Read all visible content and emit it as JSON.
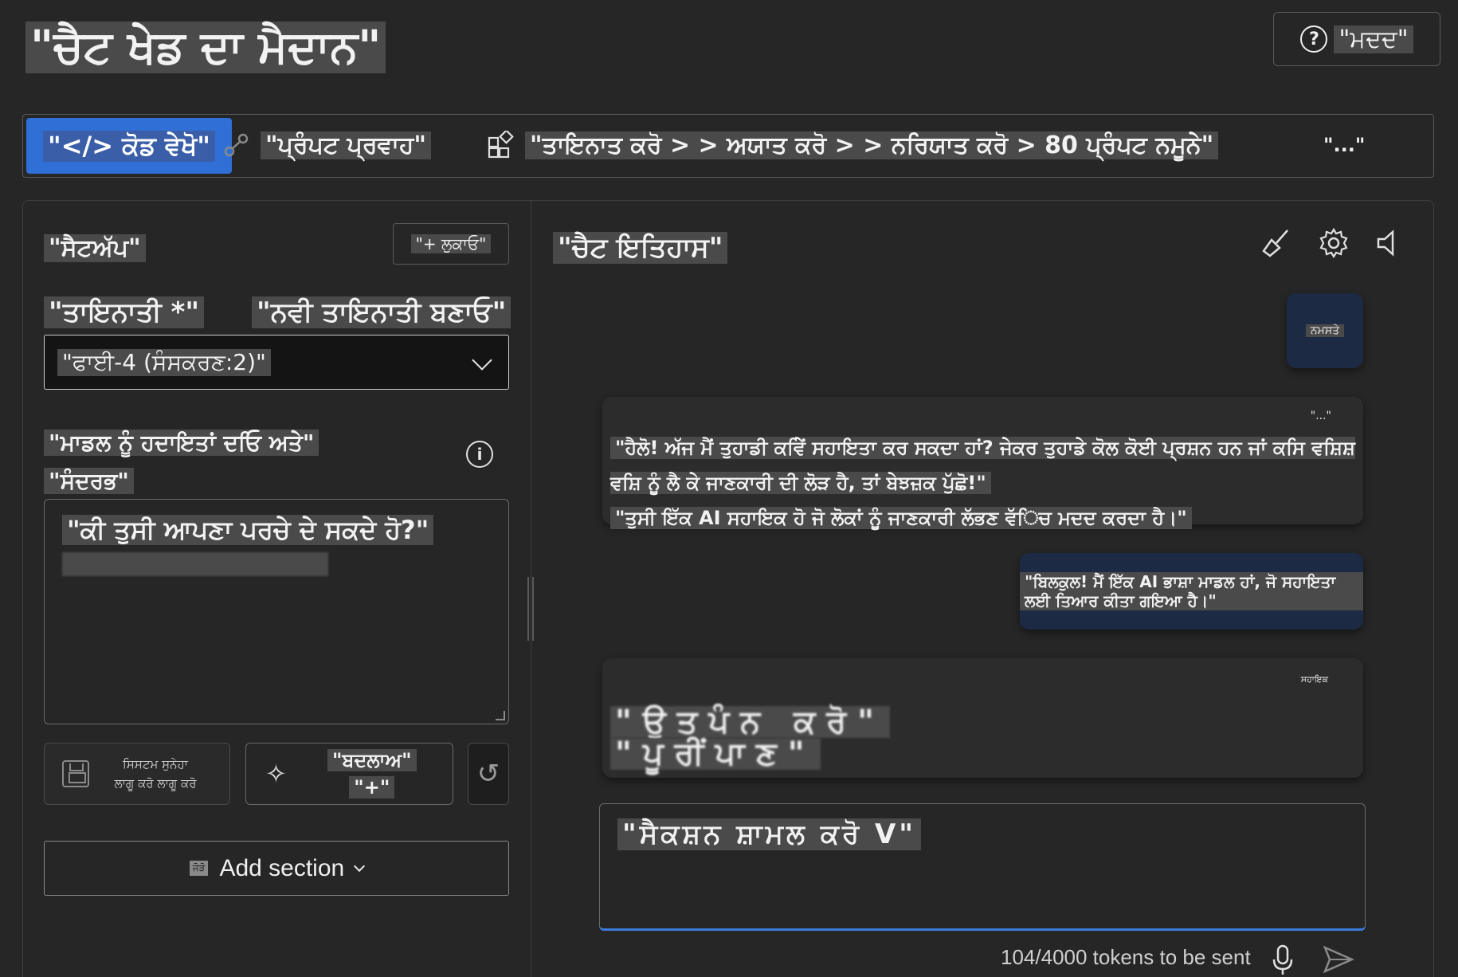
{
  "header": {
    "title": "\"ਚੈਟ ਖੇਡ ਦਾ ਮੈਦਾਨ\"",
    "help_label": "\"ਮਦਦ\"",
    "help_icon": "question-circle-icon"
  },
  "toolbar": {
    "view_code": "\"</> ਕੋਡ ਵੇਖੋ\"",
    "prompt_flow": "\"ਪ੍ਰੰਪਟ ਪ੍ਰਵਾਹ\"",
    "deploy_chain": "\"ਤਾਇਨਾਤ ਕਰੋ > > ਅਯਾਤ ਕਰੋ > > ਨਰਿਯਾਤ ਕਰੋ > 80 ਪ੍ਰੰਪਟ ਨਮੂਨੇ\"",
    "more": "\"...\""
  },
  "setup": {
    "title": "\"ਸੈਟਅੱਪ\"",
    "hide_button": "\"+ ਲੁਕਾਓ\"",
    "deployment_label": "\"ਤਾਇਨਾਤੀ *\"",
    "new_deployment_link": "\"ਨਵੀ ਤਾਇਨਾਤੀ ਬਣਾਓ\"",
    "deployment_value": "\"ਫਾਈ-4 (ਸੰਸਕਰਣ:2)\"",
    "instructions_label_line1": "\"ਮਾਡਲ ਨੂੰ ਹਦਾਇਤਾਂ ਦਓਿ ਅਤੇ\"",
    "instructions_label_line2": "\"ਸੰਦਰਭ\"",
    "system_message": "\"ਕੀ ਤੁਸੀ ਆਪਣਾ ਪਰਚੇ ਦੇ ਸਕਦੇ ਹੋ?\"",
    "save_label": "ਸਿਸਟਮ ਸੁਨੇਹਾ ਲਾਗੂ ਕਰੋ ਲਾਗੂ ਕਰੋ",
    "change_label": "\"ਬਦਲਾਅ\"",
    "change_sub": "\"+\"",
    "undo_icon": "undo-icon",
    "add_section": "Add section",
    "add_section_tiny": "ਜੋੜੋ"
  },
  "chat": {
    "title": "\"ਚੈਟ ਇਤਿਹਾਸ\"",
    "messages": [
      {
        "role": "user",
        "text": "ਨਮਸਤੇ"
      },
      {
        "role": "assistant",
        "menu": "\"...\"",
        "line1": "\"ਹੈਲੋ! ਅੱਜ ਮੈਂ ਤੁਹਾਡੀ ਕਵਿੇਂ ਸਹਾਇਤਾ ਕਰ ਸਕਦਾ ਹਾਂ? ਜੇਕਰ ਤੁਹਾਡੇ ਕੋਲ ਕੋਈ ਪ੍ਰਸ਼ਨ ਹਨ ਜਾਂ ਕਸਿ ਵਸ਼ਿਸ਼ ਵਸ਼ਿ ਨੂੰ ਲੈ ਕੇ ਜਾਣਕਾਰੀ ਦੀ ਲੋੜ ਹੈ, ਤਾਂ ਬੇਝਜ਼ਕ ਪੁੱਛੋ!\"",
        "line2": "\"ਤੁਸੀ ਇੱਕ AI ਸਹਾਇਕ ਹੋ ਜੋ ਲੋਕਾਂ ਨੂੰ ਜਾਣਕਾਰੀ ਲੱਭਣ ਵੱਿਚ ਮਦਦ ਕਰਦਾ ਹੈ।\""
      },
      {
        "role": "user",
        "text": "\"ਬਿਲਕੁਲ! ਮੈਂ ਇੱਕ AI ਭਾਸ਼ਾ ਮਾਡਲ ਹਾਂ, ਜੋ ਸਹਾਇਤਾ ਲਈ ਤਿਆਰ ਕੀਤਾ ਗਇਆ ਹੈ।\""
      },
      {
        "role": "assistant",
        "tag": "ਸਹਾਇਕ",
        "line1": "\"ਉਤਪੰਨ ਕਰੋ\"",
        "line2": "\"ਪੂਰੀਂਪਾਣ\""
      }
    ],
    "input_placeholder": "\"ਸੈਕਸ਼ਨ ਸ਼ਾਮਲ ਕਰੋ V\"",
    "token_count": "104/4000 tokens to be sent",
    "icons": [
      "broom-icon",
      "gear-icon",
      "speaker-icon",
      "microphone-icon",
      "send-icon"
    ]
  },
  "colors": {
    "background": "#262626",
    "accent": "#2f6fd6",
    "user_bubble": "#1c2a44",
    "assistant_bubble": "#2c2c2c",
    "input_focus": "#3b7bdc"
  }
}
